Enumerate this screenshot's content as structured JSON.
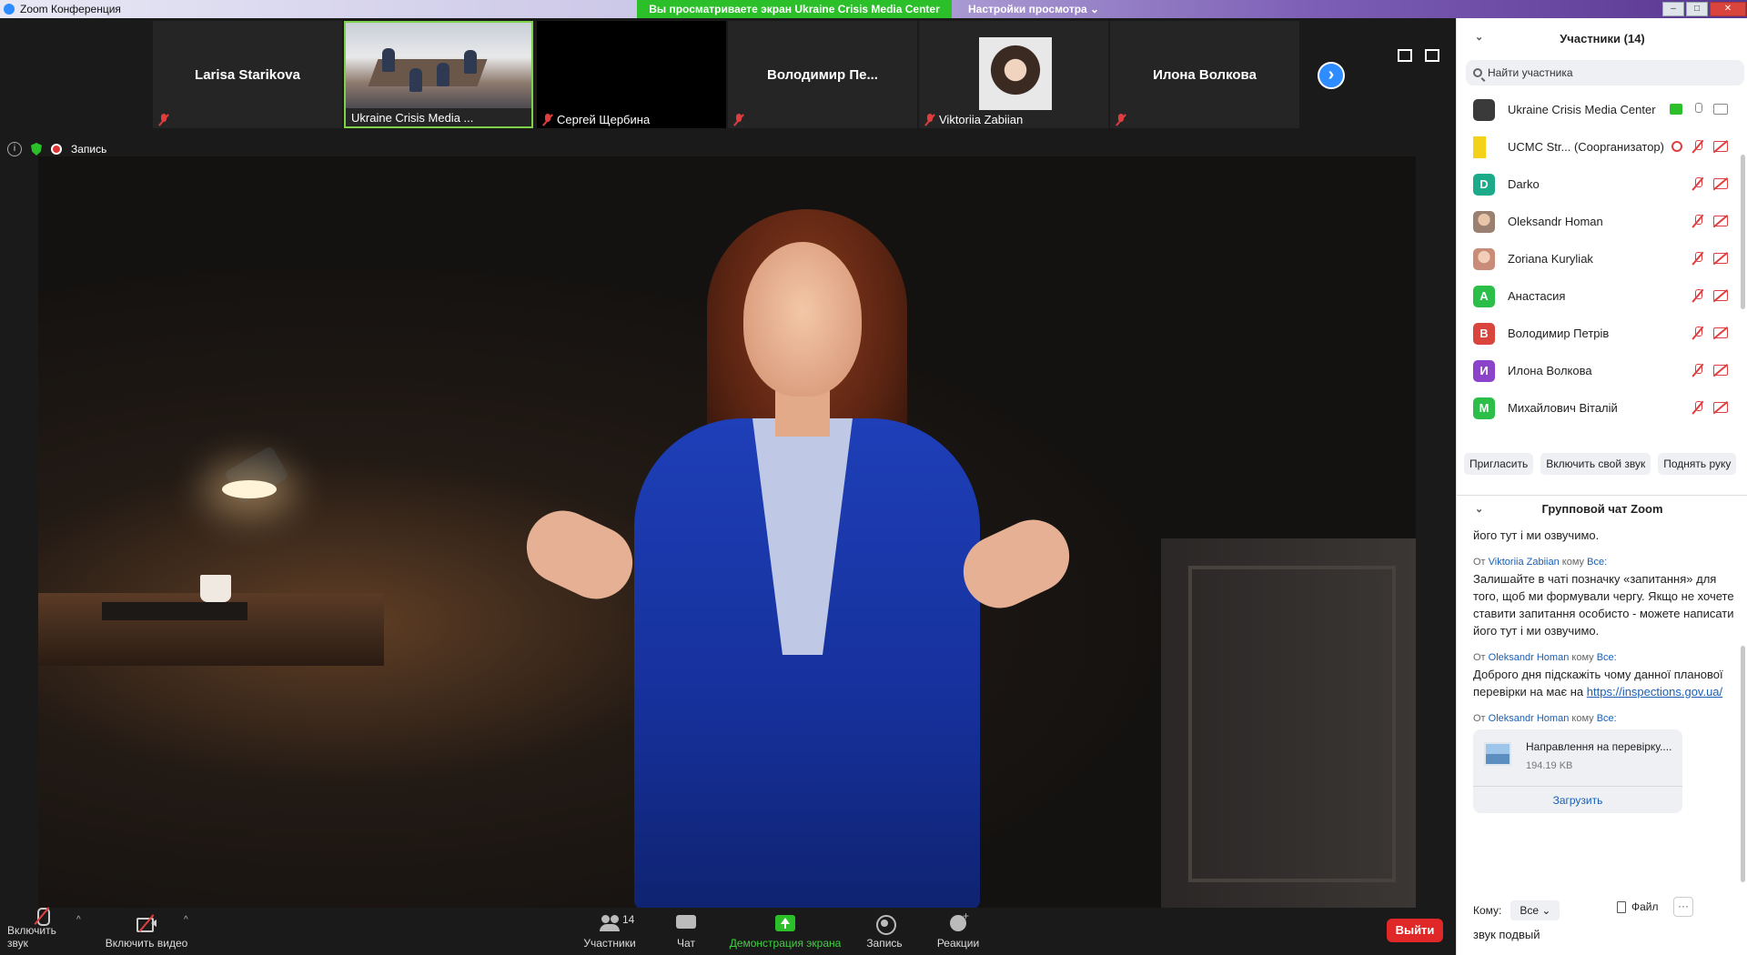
{
  "titlebar": {
    "app_title": "Zoom Конференция",
    "share_banner": "Вы просматриваете экран Ukraine Crisis Media Center",
    "view_settings": "Настройки просмотра ⌄",
    "win_min": "–",
    "win_max": "□",
    "win_close": "✕"
  },
  "strip": {
    "tiles": [
      {
        "name": "Larisa Starikova",
        "label": ""
      },
      {
        "name": "",
        "label": "Ukraine Crisis Media ..."
      },
      {
        "name": "",
        "label": "Сергей Щербина"
      },
      {
        "name": "Володимир  Пе...",
        "label": ""
      },
      {
        "name": "",
        "label": "Viktoriia Zabiian"
      },
      {
        "name": "Илона Волкова",
        "label": ""
      }
    ],
    "next_arrow": "›"
  },
  "infobar": {
    "info_glyph": "i",
    "recording_label": "Запись"
  },
  "toolbar": {
    "mute_label": "Включить звук",
    "video_label": "Включить видео",
    "participants_label": "Участники",
    "participants_count": "14",
    "chat_label": "Чат",
    "share_label": "Демонстрация экрана",
    "record_label": "Запись",
    "reactions_label": "Реакции",
    "leave_label": "Выйти",
    "caret": "^"
  },
  "participants": {
    "header": "Участники (14)",
    "search_placeholder": "Найти участника",
    "list": [
      {
        "name": "Ukraine Crisis Media Center",
        "initial": "",
        "color": "#3a3a3a"
      },
      {
        "name": "UCMC Str... (Соорганизатор)",
        "initial": "",
        "color": "#f5d21a"
      },
      {
        "name": "Darko",
        "initial": "D",
        "color": "#1bab8a"
      },
      {
        "name": "Oleksandr Homan",
        "initial": "",
        "color": "#c9b8a6"
      },
      {
        "name": "Zoriana Kuryliak",
        "initial": "",
        "color": "#e8b4a0"
      },
      {
        "name": "Анастасия",
        "initial": "A",
        "color": "#2bbf4a"
      },
      {
        "name": "Володимир Петрів",
        "initial": "В",
        "color": "#d9453c"
      },
      {
        "name": "Илона Волкова",
        "initial": "И",
        "color": "#8a43c9"
      },
      {
        "name": "Михайлович Віталій",
        "initial": "M",
        "color": "#2bbf4a"
      }
    ],
    "invite_label": "Пригласить",
    "unmute_self_label": "Включить свой звук",
    "raise_hand_label": "Поднять руку",
    "collapse_glyph": "⌄"
  },
  "chat": {
    "header": "Групповой чат Zoom",
    "tail_text": "його тут і ми озвучимо.",
    "messages": [
      {
        "from_prefix": "От",
        "sender": "Viktoriia Zabiian",
        "to_prefix": "кому",
        "recipient": "Все:",
        "text": "Залишайте в чаті позначку «запитання» для того, щоб ми формували чергу. Якщо не хочете ставити запитання особисто - можете написати його тут і ми озвучимо."
      },
      {
        "from_prefix": "От",
        "sender": "Oleksandr Homan",
        "to_prefix": "кому",
        "recipient": "Все:",
        "text": "Доброго дня підскажіть чому данної планової перевірки на має на",
        "link": "https://inspections.gov.ua/"
      },
      {
        "from_prefix": "От",
        "sender": "Oleksandr Homan",
        "to_prefix": "кому",
        "recipient": "Все:",
        "file_name": "Направлення на перевірку....",
        "file_size": "194.19 KB",
        "download_label": "Загрузить"
      }
    ],
    "to_label": "Кому:",
    "to_value": "Все ⌄",
    "file_label": "Файл",
    "more_glyph": "···",
    "input_text": "звук подвый"
  }
}
